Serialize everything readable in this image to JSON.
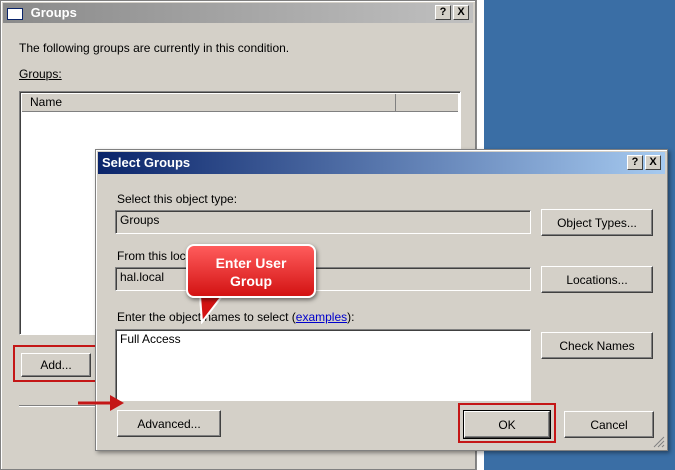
{
  "groups_window": {
    "title": "Groups",
    "help_button": "?",
    "close_button": "X",
    "description": "The following groups are currently in this condition.",
    "groups_label": "Groups:",
    "column_header": "Name",
    "add_button": "Add..."
  },
  "dialog": {
    "title": "Select Groups",
    "help_button": "?",
    "close_button": "X",
    "object_type_label": "Select this object type:",
    "object_type_value": "Groups",
    "object_types_button": "Object Types...",
    "location_label": "From this locati",
    "location_value": "hal.local",
    "locations_button": "Locations...",
    "names_label_prefix": "Enter the object names to select (",
    "names_label_link": "examples",
    "names_label_suffix": "):",
    "names_value": "Full Access",
    "check_names_button": "Check Names",
    "advanced_button": "Advanced...",
    "ok_button": "OK",
    "cancel_button": "Cancel"
  },
  "callout": {
    "text": "Enter User Group"
  },
  "colors": {
    "highlight": "#c41616",
    "active_title": "#0a246a",
    "desktop": "#3a6ea5"
  }
}
